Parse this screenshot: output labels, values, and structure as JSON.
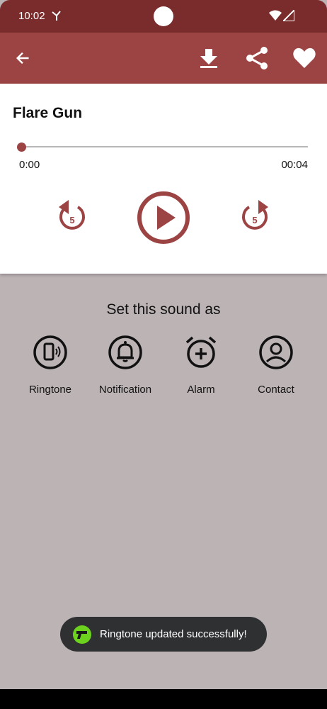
{
  "status_bar": {
    "time": "10:02"
  },
  "app_bar": {
    "back_icon": "arrow-left-icon",
    "actions": [
      "download-icon",
      "share-icon",
      "heart-icon"
    ]
  },
  "player": {
    "title": "Flare Gun",
    "current_time": "0:00",
    "duration": "00:04",
    "progress": 0,
    "rewind_seconds": "5",
    "forward_seconds": "5"
  },
  "set_as": {
    "heading": "Set this sound as",
    "options": [
      {
        "label": "Ringtone",
        "icon": "phone-vibrate-icon"
      },
      {
        "label": "Notification",
        "icon": "bell-icon"
      },
      {
        "label": "Alarm",
        "icon": "alarm-add-icon"
      },
      {
        "label": "Contact",
        "icon": "contact-icon"
      }
    ]
  },
  "toast": {
    "message": "Ringtone updated successfully!"
  },
  "colors": {
    "accent": "#9c4444",
    "status_bar": "#7a2b2b",
    "background": "#bcb3b5"
  }
}
